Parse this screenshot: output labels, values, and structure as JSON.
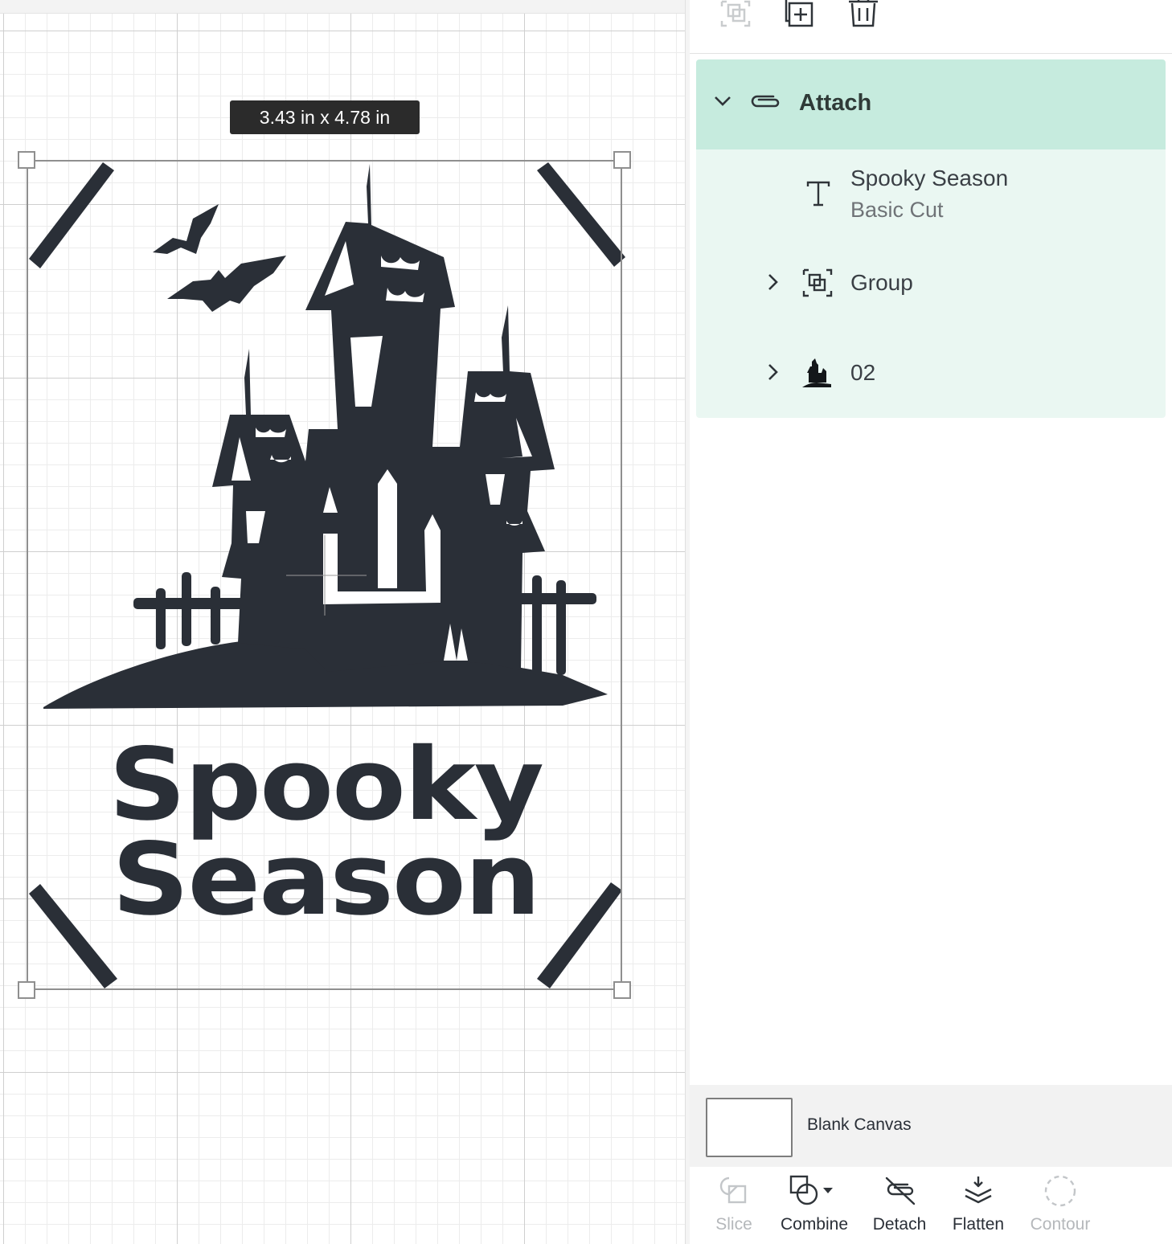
{
  "canvas": {
    "dimensions_label": "3.43  in x 4.78  in",
    "design_text": [
      "Spooky",
      "Season"
    ],
    "ink_color": "#2a2f37"
  },
  "layer_toolbar": {
    "icons": [
      "ungroup-icon",
      "duplicate-icon",
      "delete-icon"
    ]
  },
  "layers": {
    "attach": {
      "label": "Attach",
      "expanded": true,
      "icon": "paperclip-icon"
    },
    "items": [
      {
        "name": "Spooky Season",
        "operation": "Basic Cut",
        "icon": "text-icon"
      },
      {
        "name": "Group",
        "icon": "group-icon",
        "expanded": false
      },
      {
        "name": "02",
        "icon": "haunted-house-thumbnail-icon",
        "expanded": false
      }
    ],
    "highlight_color": "#c6ebde",
    "body_color": "#eaf7f2"
  },
  "canvas_row": {
    "label": "Blank Canvas"
  },
  "bottom_tools": {
    "slice": {
      "label": "Slice",
      "enabled": false
    },
    "combine": {
      "label": "Combine",
      "enabled": true
    },
    "detach": {
      "label": "Detach",
      "enabled": true
    },
    "flatten": {
      "label": "Flatten",
      "enabled": true
    },
    "contour": {
      "label": "Contour",
      "enabled": false
    }
  }
}
